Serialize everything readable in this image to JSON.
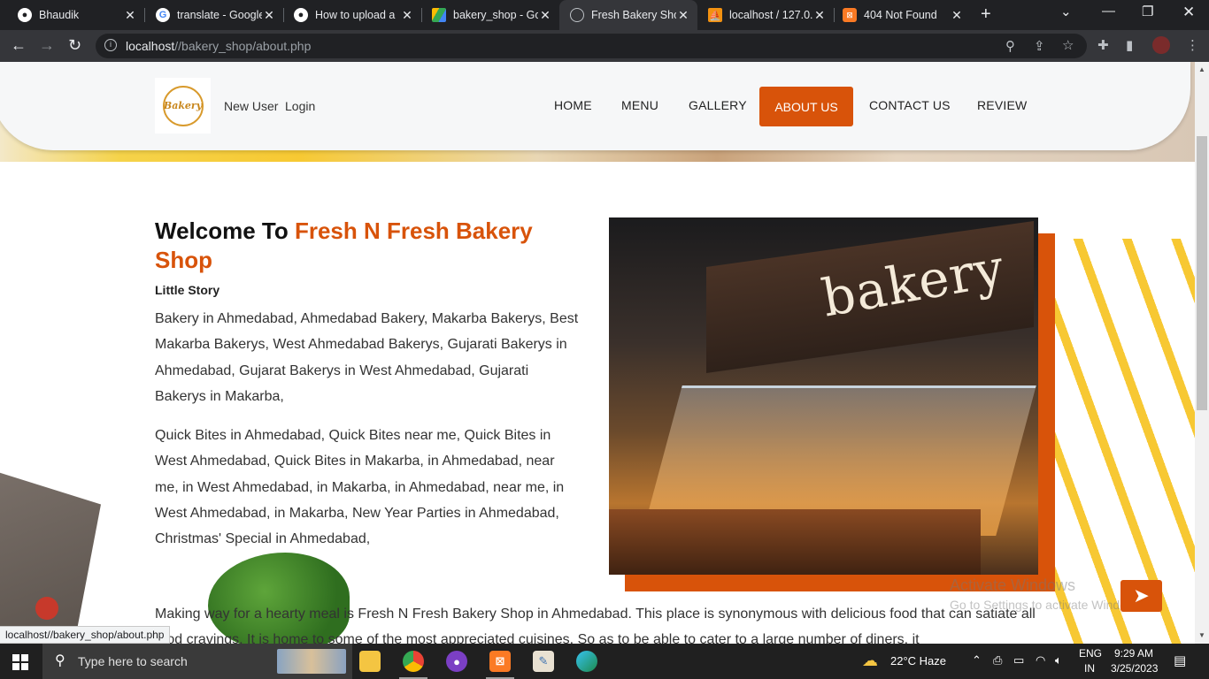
{
  "browser": {
    "tabs": [
      {
        "title": "Bhaudik",
        "icon": "github-icon"
      },
      {
        "title": "translate - Google",
        "icon": "google-icon"
      },
      {
        "title": "How to upload a",
        "icon": "github-icon"
      },
      {
        "title": "bakery_shop - Go",
        "icon": "google-drive-icon"
      },
      {
        "title": "Fresh Bakery Sho",
        "icon": "globe-icon"
      },
      {
        "title": "localhost / 127.0.",
        "icon": "phpmyadmin-icon"
      },
      {
        "title": "404 Not Found",
        "icon": "xampp-icon"
      }
    ],
    "active_tab": 4,
    "url_host": "localhost",
    "url_path": "//bakery_shop/about.php",
    "status_url": "localhost//bakery_shop/about.php"
  },
  "site": {
    "logo_text": "Bakery",
    "header_links": {
      "new_user": "New User",
      "login": "Login"
    },
    "menu": [
      "HOME",
      "MENU",
      "GALLERY",
      "ABOUT US",
      "CONTACT US",
      "REVIEW"
    ],
    "active_menu": "ABOUT US",
    "accent_color": "#d8530a"
  },
  "about": {
    "welcome_prefix": "Welcome To ",
    "welcome_accent": "Fresh N Fresh Bakery Shop",
    "subtitle": "Little Story",
    "para1": "Bakery in Ahmedabad, Ahmedabad Bakery, Makarba Bakerys, Best Makarba Bakerys, West Ahmedabad Bakerys, Gujarati Bakerys in Ahmedabad, Gujarat Bakerys in West Ahmedabad, Gujarati Bakerys in Makarba,",
    "para2": "Quick Bites in Ahmedabad, Quick Bites near me, Quick Bites in West Ahmedabad, Quick Bites in Makarba, in Ahmedabad, near me, in West Ahmedabad, in Makarba, in Ahmedabad, near me, in West Ahmedabad, in Makarba, New Year Parties in Ahmedabad, Christmas' Special in Ahmedabad,",
    "para3": "Making way for a hearty meal is Fresh N Fresh Bakery Shop in Ahmedabad. This place is synonymous with delicious food that can satiate all food cravings. It is home to some of the most appreciated cuisines. So as to be able to cater to a large number of diners, it",
    "image_sign": "bakery"
  },
  "watermark": {
    "line1": "Activate Windows",
    "line2": "Go to Settings to activate Windows."
  },
  "taskbar": {
    "search_placeholder": "Type here to search",
    "apps": [
      "file-explorer-icon",
      "chrome-icon",
      "github-desktop-icon",
      "xampp-icon",
      "paint-icon",
      "edge-icon"
    ],
    "weather": "22°C  Haze",
    "language": "ENG",
    "region": "IN",
    "time": "9:29 AM",
    "date": "3/25/2023"
  }
}
